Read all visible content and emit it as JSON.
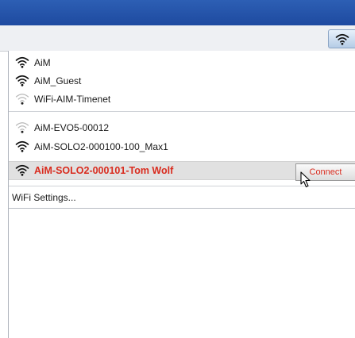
{
  "networks_known": [
    {
      "name": "AiM",
      "signal": "strong"
    },
    {
      "name": "AiM_Guest",
      "signal": "strong"
    },
    {
      "name": "WiFi-AIM-Timenet",
      "signal": "weak"
    }
  ],
  "networks_other": [
    {
      "name": "AiM-EVO5-00012",
      "signal": "weak"
    },
    {
      "name": "AiM-SOLO2-000100-100_Max1",
      "signal": "strong"
    },
    {
      "name": "AiM-SOLO2-000101-Tom Wolf",
      "signal": "strong",
      "selected": true
    }
  ],
  "connect_label": "Connect",
  "settings_label": "WiFi Settings...",
  "colors": {
    "titlebar": "#1e4aa0",
    "selected_text": "#d92b1e",
    "selected_row": "#e1e1e1"
  },
  "icons": {
    "network": "wifi-icon",
    "toolbar": "wifi-icon",
    "pointer": "mouse-cursor-icon"
  }
}
